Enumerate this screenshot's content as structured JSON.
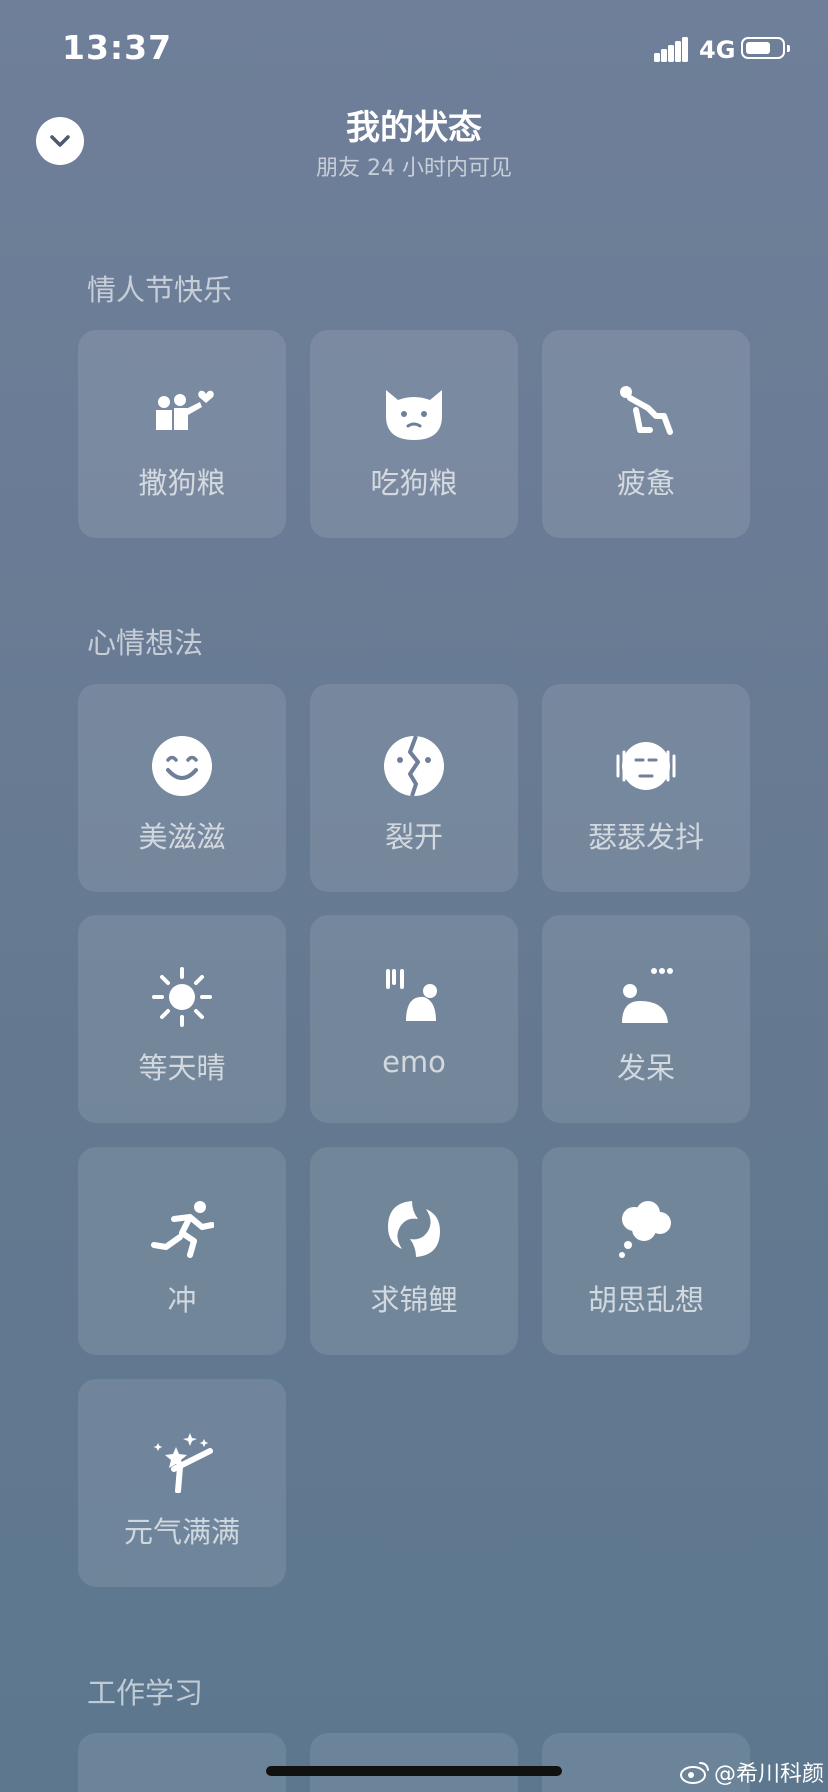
{
  "status_bar": {
    "time": "13:37",
    "network": "4G",
    "battery_level": 0.7
  },
  "header": {
    "title": "我的状态",
    "subtitle": "朋友 24 小时内可见",
    "collapse_icon": "chevron-down-icon"
  },
  "sections": [
    {
      "title": "情人节快乐",
      "items": [
        {
          "label": "撒狗粮",
          "icon": "couple-heart-icon"
        },
        {
          "label": "吃狗粮",
          "icon": "dog-face-icon"
        },
        {
          "label": "疲惫",
          "icon": "tired-person-icon"
        }
      ]
    },
    {
      "title": "心情想法",
      "items": [
        {
          "label": "美滋滋",
          "icon": "smile-face-icon"
        },
        {
          "label": "裂开",
          "icon": "cracked-face-icon"
        },
        {
          "label": "瑟瑟发抖",
          "icon": "shivering-face-icon"
        },
        {
          "label": "等天晴",
          "icon": "sun-icon"
        },
        {
          "label": "emo",
          "icon": "sad-crouching-person-icon"
        },
        {
          "label": "发呆",
          "icon": "daze-person-icon"
        },
        {
          "label": "冲",
          "icon": "running-person-icon"
        },
        {
          "label": "求锦鲤",
          "icon": "koi-fish-icon"
        },
        {
          "label": "胡思乱想",
          "icon": "thought-bubble-icon"
        },
        {
          "label": "元气满满",
          "icon": "energetic-person-icon"
        }
      ]
    },
    {
      "title": "工作学习",
      "items": []
    }
  ],
  "watermark": "@希川科颜",
  "colors": {
    "background": "#6a7c95",
    "card": "rgba(255,255,255,0.1)"
  }
}
